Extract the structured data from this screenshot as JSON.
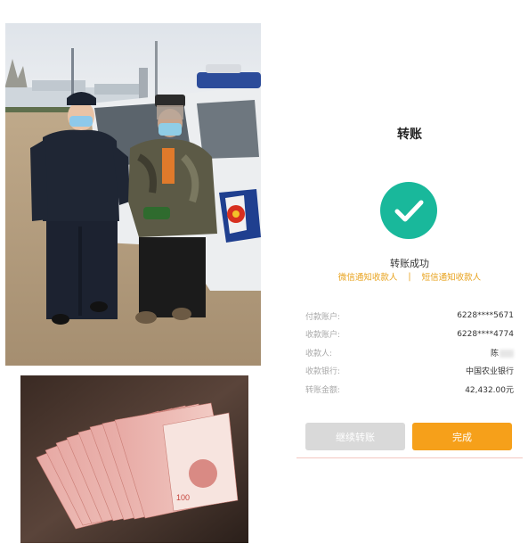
{
  "transfer": {
    "title": "转账",
    "status": "转账成功",
    "notify_payee_wechat": "微信通知收款人",
    "separator": "|",
    "notify_payee_sms": "短信通知收款人",
    "rows": [
      {
        "label": "付款账户:",
        "value": "6228****5671"
      },
      {
        "label": "收款账户:",
        "value": "6228****4774"
      },
      {
        "label": "收款人:",
        "value": "陈"
      },
      {
        "label": "收款银行:",
        "value": "中国农业银行"
      },
      {
        "label": "转账金额:",
        "value": "42,432.00元"
      }
    ],
    "continue_button": "继续转账",
    "done_button": "完成"
  },
  "colors": {
    "success_green": "#19b89b",
    "accent_orange": "#f6a01a",
    "link_yellow": "#e8a21c",
    "disabled_gray": "#d9d9d9"
  },
  "icons": {
    "success": "checkmark-icon"
  }
}
